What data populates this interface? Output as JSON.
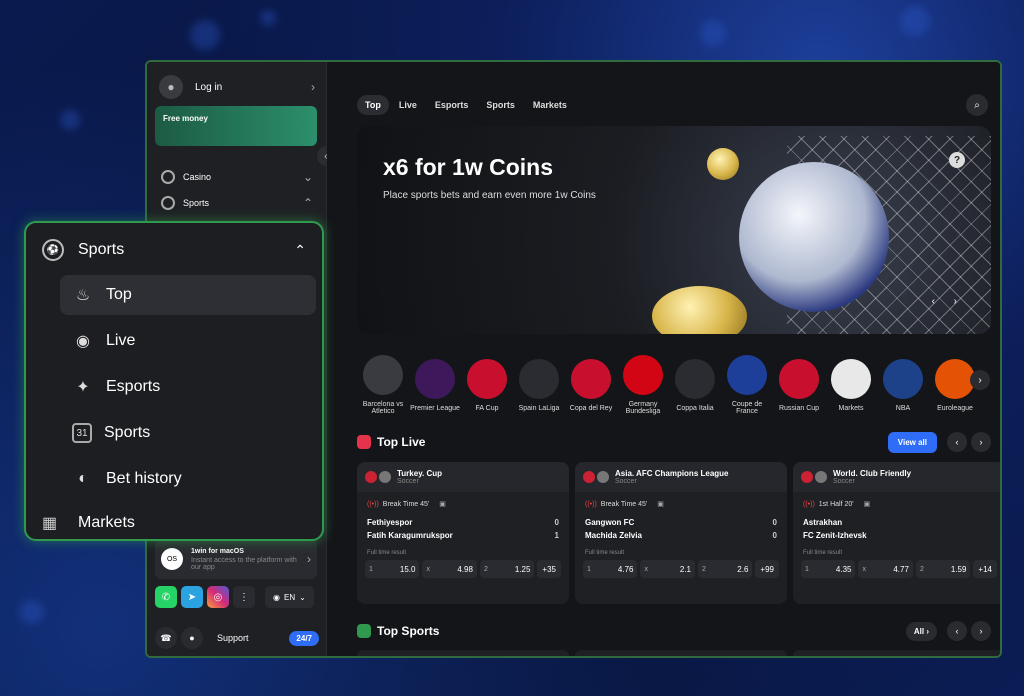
{
  "sidebar": {
    "login": "Log in",
    "free_money": "Free money",
    "nav": [
      {
        "label": "Casino",
        "icon": "casino-icon"
      },
      {
        "label": "Sports",
        "icon": "soccer-ball-icon"
      }
    ],
    "macos_title": "1win for macOS",
    "macos_desc": "Instant access to the platform with our app",
    "lang": "EN",
    "support": "Support",
    "support_badge": "24/7"
  },
  "popup": {
    "title": "Sports",
    "items": [
      {
        "label": "Top",
        "icon": "fire-icon",
        "active": true
      },
      {
        "label": "Live",
        "icon": "broadcast-icon"
      },
      {
        "label": "Esports",
        "icon": "gamepad-icon"
      },
      {
        "label": "Sports",
        "icon": "calendar-icon"
      },
      {
        "label": "Bet history",
        "icon": "coins-icon"
      }
    ],
    "markets": "Markets"
  },
  "tabs": [
    "Top",
    "Live",
    "Esports",
    "Sports",
    "Markets"
  ],
  "banner": {
    "title": "x6 for 1w Coins",
    "subtitle": "Place sports bets and earn even more 1w Coins"
  },
  "leagues": [
    {
      "label": "Barcelona vs Atletico",
      "color": "#3a3b40"
    },
    {
      "label": "Premier League",
      "color": "#3d195b"
    },
    {
      "label": "FA Cup",
      "color": "#c8102e"
    },
    {
      "label": "Spain LaLiga",
      "color": "#2b2c31"
    },
    {
      "label": "Copa del Rey",
      "color": "#c8102e"
    },
    {
      "label": "Germany Bundesliga",
      "color": "#d20515"
    },
    {
      "label": "Coppa Italia",
      "color": "#2b2c31"
    },
    {
      "label": "Coupe de France",
      "color": "#1d3f9a"
    },
    {
      "label": "Russian Cup",
      "color": "#c8102e"
    },
    {
      "label": "Markets",
      "color": "#e8e8e8"
    },
    {
      "label": "NBA",
      "color": "#1d428a"
    },
    {
      "label": "Euroleague",
      "color": "#e35205"
    }
  ],
  "top_live": {
    "title": "Top Live",
    "view_all": "View all",
    "cards": [
      {
        "league": "Turkey. Cup",
        "sport": "Soccer",
        "status": "Break Time 45'",
        "team1": "Fethiyespor",
        "score1": "0",
        "team2": "Fatih Karagumrukspor",
        "score2": "1",
        "result_label": "Full time result",
        "odds": [
          {
            "k": "1",
            "v": "15.0"
          },
          {
            "k": "x",
            "v": "4.98"
          },
          {
            "k": "2",
            "v": "1.25"
          }
        ],
        "more": "+35"
      },
      {
        "league": "Asia. AFC Champions League",
        "sport": "Soccer",
        "status": "Break Time 45'",
        "team1": "Gangwon FC",
        "score1": "0",
        "team2": "Machida Zelvia",
        "score2": "0",
        "result_label": "Full time result",
        "odds": [
          {
            "k": "1",
            "v": "4.76"
          },
          {
            "k": "x",
            "v": "2.1"
          },
          {
            "k": "2",
            "v": "2.6"
          }
        ],
        "more": "+99"
      },
      {
        "league": "World. Club Friendly",
        "sport": "Soccer",
        "status": "1st Half 20'",
        "team1": "Astrakhan",
        "score1": "",
        "team2": "FC Zenit-Izhevsk",
        "score2": "",
        "result_label": "Full time result",
        "odds": [
          {
            "k": "1",
            "v": "4.35"
          },
          {
            "k": "x",
            "v": "4.77"
          },
          {
            "k": "2",
            "v": "1.59"
          }
        ],
        "more": "+14"
      }
    ]
  },
  "top_sports": {
    "title": "Top Sports",
    "all": "All"
  }
}
